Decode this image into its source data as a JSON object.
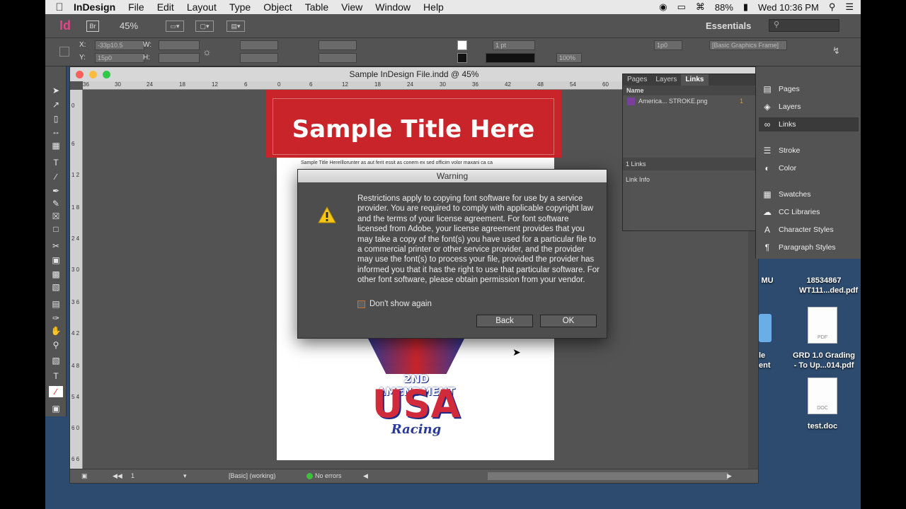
{
  "menubar": {
    "app": "InDesign",
    "items": [
      "File",
      "Edit",
      "Layout",
      "Type",
      "Object",
      "Table",
      "View",
      "Window",
      "Help"
    ],
    "battery": "88%",
    "clock": "Wed 10:36 PM"
  },
  "appbar": {
    "logo": "Id",
    "bridge": "Br",
    "zoom": "45%",
    "workspace": "Essentials"
  },
  "control": {
    "x_label": "X:",
    "x_value": "-33p10.5",
    "y_label": "Y:",
    "y_value": "15p0",
    "w_label": "W:",
    "h_label": "H:",
    "stroke_weight": "1 pt",
    "zoom_pct": "100%",
    "spacing": "1p0",
    "frame_style": "[Basic Graphics Frame]"
  },
  "document": {
    "title": "Sample InDesign File.indd @ 45%",
    "ruler_h": [
      "36",
      "30",
      "24",
      "18",
      "12",
      "6",
      "0",
      "6",
      "12",
      "18",
      "24",
      "30",
      "36",
      "42",
      "48",
      "54",
      "60"
    ],
    "ruler_v": [
      "0",
      "6",
      "1 2",
      "1 8",
      "2 4",
      "3 0",
      "3 6",
      "4 2",
      "4 8",
      "5 4",
      "6 0",
      "6 6"
    ],
    "banner_title": "Sample Title Here",
    "body_text": "Sample Title HereIllorunter as aut ferit essit as conem ex sed officim volor maxani ca ca",
    "artwork_line1": "2ND AMENDMENT",
    "artwork_line2": "USA",
    "artwork_line3": "Racing"
  },
  "status": {
    "page": "1",
    "style": "[Basic] (working)",
    "errors": "No errors"
  },
  "warning": {
    "title": "Warning",
    "message": "Restrictions apply to copying font software for use by a service provider.  You are required to comply with applicable copyright law and the terms of your license agreement.  For font software licensed from Adobe, your license agreement provides that you may take a copy of the font(s) you have used for a particular file to a commercial printer or other service provider, and the provider may use the font(s) to process your file, provided the provider has informed you that it has the right to use that particular software.  For other font software, please obtain permission from your vendor.",
    "checkbox": "Don't show again",
    "back": "Back",
    "ok": "OK"
  },
  "links_panel": {
    "tabs": [
      "Pages",
      "Layers",
      "Links"
    ],
    "column": "Name",
    "link_name": "America... STROKE.png",
    "link_page": "1",
    "count": "1 Links",
    "info": "Link Info"
  },
  "dock": [
    {
      "label": "Pages",
      "icon": "pages-icon"
    },
    {
      "label": "Layers",
      "icon": "layers-icon"
    },
    {
      "label": "Links",
      "icon": "links-icon"
    },
    {
      "label": "Stroke",
      "icon": "stroke-icon"
    },
    {
      "label": "Color",
      "icon": "color-icon"
    },
    {
      "label": "Swatches",
      "icon": "swatches-icon"
    },
    {
      "label": "CC Libraries",
      "icon": "cc-libraries-icon"
    },
    {
      "label": "Character Styles",
      "icon": "character-styles-icon"
    },
    {
      "label": "Paragraph Styles",
      "icon": "paragraph-styles-icon"
    }
  ],
  "desktop": {
    "file1_line1": "18534867",
    "file1_line2": "WT111...ded.pdf",
    "file2_line1": "GRD 1.0 Grading",
    "file2_line2": "- To Up...014.pdf",
    "file2_badge": "PDF",
    "file3": "test.doc",
    "file3_badge": "DOC",
    "partial1": "MU",
    "partial2_line1": "le",
    "partial2_line2": "ent"
  },
  "colors": {
    "banner": "#c8242a",
    "accent": "#e8902a",
    "indesign": "#e0468a"
  }
}
